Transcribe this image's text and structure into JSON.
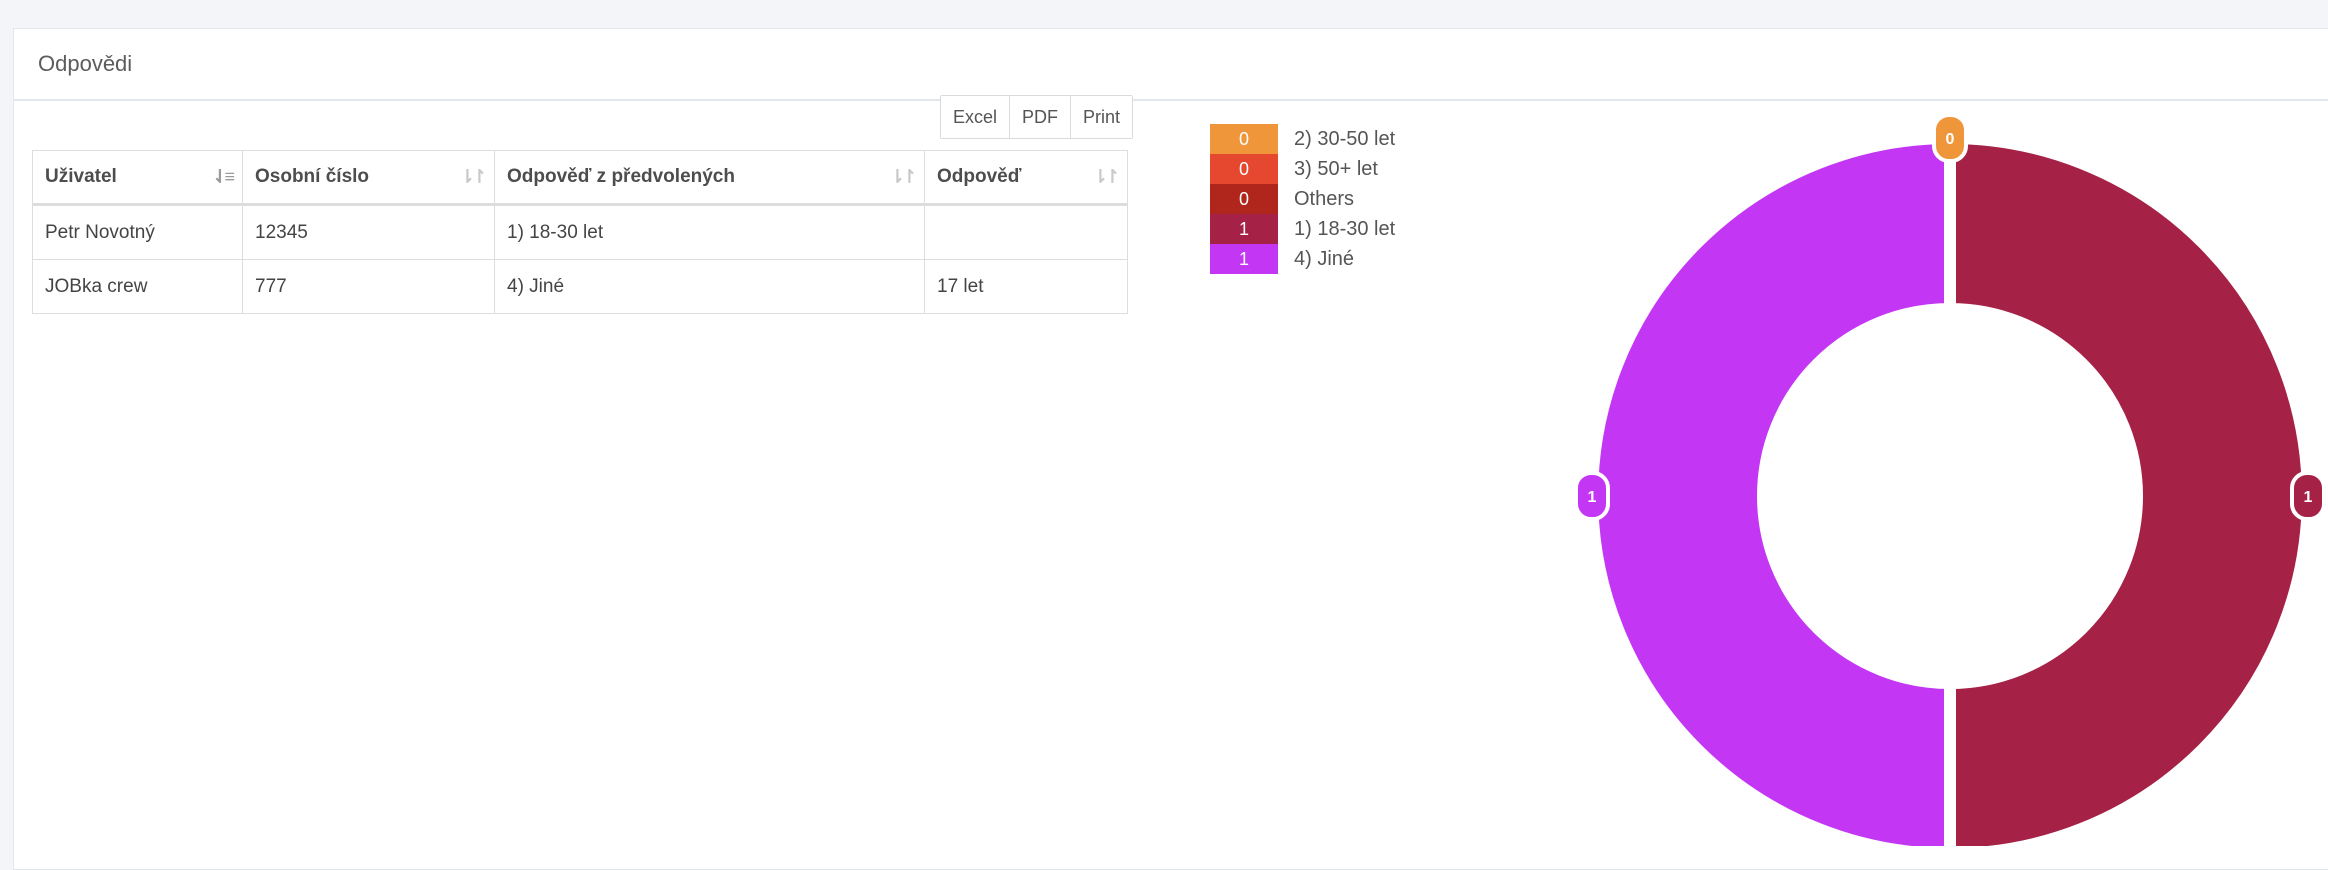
{
  "panel": {
    "title": "Odpovědi"
  },
  "toolbar": {
    "excel": "Excel",
    "pdf": "PDF",
    "print": "Print"
  },
  "table": {
    "headers": [
      "Uživatel",
      "Osobní číslo",
      "Odpověď z předvolených",
      "Odpověď"
    ],
    "rows": [
      [
        "Petr Novotný",
        "12345",
        "1) 18-30 let",
        ""
      ],
      [
        "JOBka crew",
        "777",
        "4) Jiné",
        "17 let"
      ]
    ]
  },
  "chart_data": {
    "type": "pie",
    "variant": "donut",
    "legend_position": "top-left",
    "series": [
      {
        "name": "2) 30-50 let",
        "value": 0,
        "color": "#f0963a"
      },
      {
        "name": "3) 50+ let",
        "value": 0,
        "color": "#e5482f"
      },
      {
        "name": "Others",
        "value": 0,
        "color": "#b0261c"
      },
      {
        "name": "1) 18-30 let",
        "value": 1,
        "color": "#a52146"
      },
      {
        "name": "4) Jiné",
        "value": 1,
        "color": "#c236f4"
      }
    ]
  }
}
